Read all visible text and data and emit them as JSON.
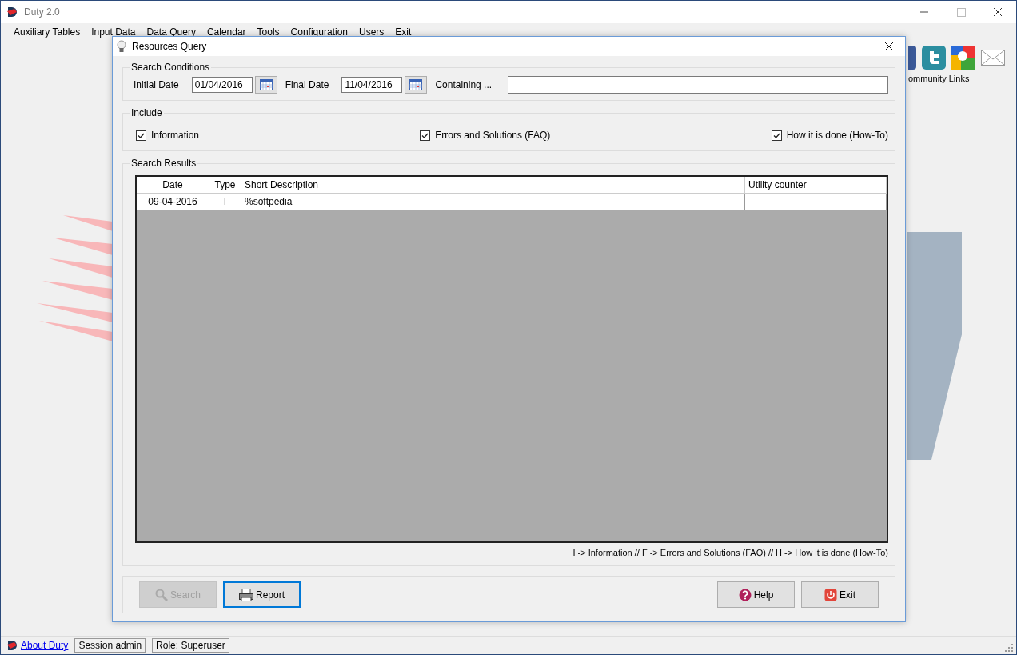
{
  "window": {
    "title": "Duty 2.0"
  },
  "menu": [
    "Auxiliary Tables",
    "Input Data",
    "Data Query",
    "Calendar",
    "Tools",
    "Configuration",
    "Users",
    "Exit"
  ],
  "community": {
    "label": "ommunity Links"
  },
  "dialog": {
    "title": "Resources Query",
    "search_conditions": {
      "title": "Search Conditions",
      "initial_date": {
        "label": "Initial Date",
        "value": "01/04/2016"
      },
      "final_date": {
        "label": "Final Date",
        "value": "11/04/2016"
      },
      "containing": {
        "label": "Containing ..."
      }
    },
    "include": {
      "title": "Include",
      "options": [
        {
          "label": "Information",
          "checked": true
        },
        {
          "label": "Errors and Solutions (FAQ)",
          "checked": true
        },
        {
          "label": "How it is done (How-To)",
          "checked": true
        }
      ]
    },
    "results": {
      "title": "Search Results",
      "columns": [
        "Date",
        "Type",
        "Short Description",
        "Utility counter"
      ],
      "rows": [
        {
          "date": "09-04-2016",
          "type": "I",
          "short_description": "%softpedia"
        }
      ],
      "legend": "I -> Information // F -> Errors and Solutions (FAQ) // H -> How it is done (How-To)"
    },
    "buttons": [
      {
        "label": "Search",
        "kind": "search",
        "disabled": true,
        "focused": false
      },
      {
        "label": "Report",
        "kind": "report",
        "disabled": false,
        "focused": true
      },
      {
        "label": "Help",
        "kind": "help",
        "disabled": false,
        "focused": false
      },
      {
        "label": "Exit",
        "kind": "exit",
        "disabled": false,
        "focused": false
      }
    ]
  },
  "status_bar": {
    "link": "About Duty",
    "session": "Session admin",
    "role": "Role: Superuser"
  }
}
